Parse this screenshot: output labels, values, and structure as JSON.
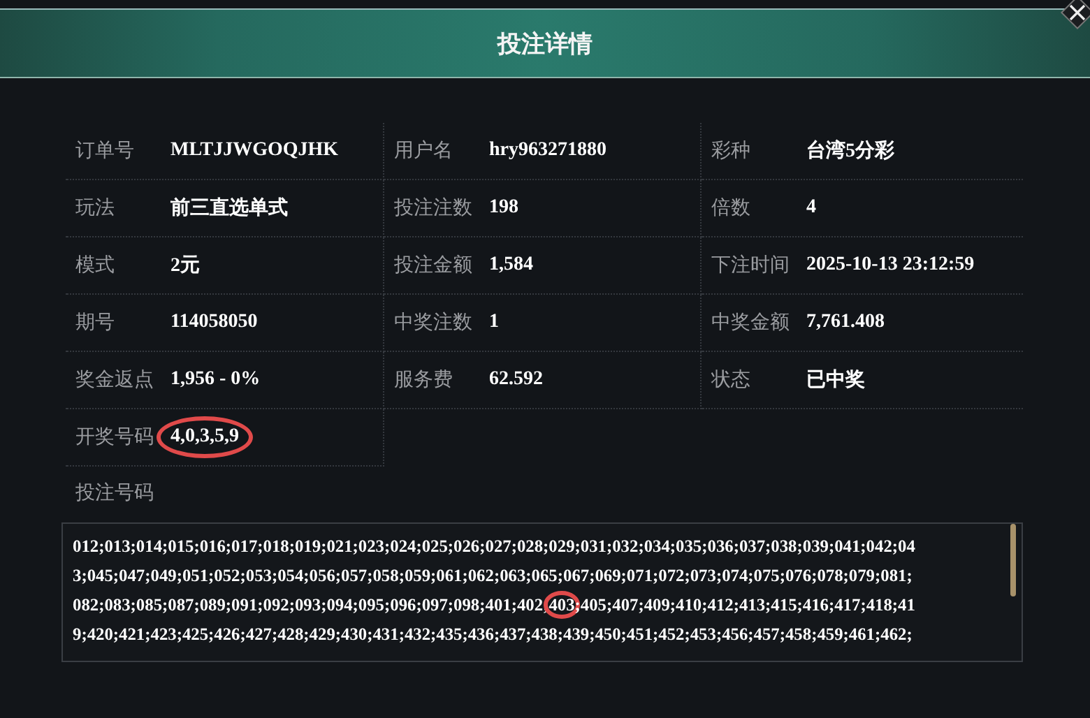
{
  "dialog": {
    "title": "投注详情"
  },
  "fields": [
    {
      "label": "订单号",
      "value": "MLTJJWGOQJHK",
      "circled": false
    },
    {
      "label": "用户名",
      "value": "hry963271880",
      "circled": false
    },
    {
      "label": "彩种",
      "value": "台湾5分彩",
      "circled": false
    },
    {
      "label": "玩法",
      "value": "前三直选单式",
      "circled": false
    },
    {
      "label": "投注注数",
      "value": "198",
      "circled": false
    },
    {
      "label": "倍数",
      "value": "4",
      "circled": false
    },
    {
      "label": "模式",
      "value": "2元",
      "circled": false
    },
    {
      "label": "投注金额",
      "value": "1,584",
      "circled": false
    },
    {
      "label": "下注时间",
      "value": "2025-10-13 23:12:59",
      "circled": false
    },
    {
      "label": "期号",
      "value": "114058050",
      "circled": false
    },
    {
      "label": "中奖注数",
      "value": "1",
      "circled": false
    },
    {
      "label": "中奖金额",
      "value": "7,761.408",
      "circled": false
    },
    {
      "label": "奖金返点",
      "value": "1,956 - 0%",
      "circled": false
    },
    {
      "label": "服务费",
      "value": "62.592",
      "circled": false
    },
    {
      "label": "状态",
      "value": "已中奖",
      "circled": false
    },
    {
      "label": "开奖号码",
      "value": "4,0,3,5,9",
      "circled": true
    }
  ],
  "bet_numbers": {
    "label": "投注号码",
    "lines": [
      [
        {
          "text": "012;013;014;015;016;017;018;019;021;023;024;025;026;027;028;029;031;032;034;035;036;037;038;039;041;042;04",
          "circled": false
        }
      ],
      [
        {
          "text": "3;045;047;049;051;052;053;054;056;057;058;059;061;062;063;065;067;069;071;072;073;074;075;076;078;079;081;",
          "circled": false
        }
      ],
      [
        {
          "text": "082;083;085;087;089;091;092;093;094;095;096;097;098;401;402;",
          "circled": false
        },
        {
          "text": "403",
          "circled": true
        },
        {
          "text": ";405;407;409;410;412;413;415;416;417;418;41",
          "circled": false
        }
      ],
      [
        {
          "text": "9;420;421;423;425;426;427;428;429;430;431;432;435;436;437;438;439;450;451;452;453;456;457;458;459;461;462;",
          "circled": false
        }
      ]
    ]
  }
}
